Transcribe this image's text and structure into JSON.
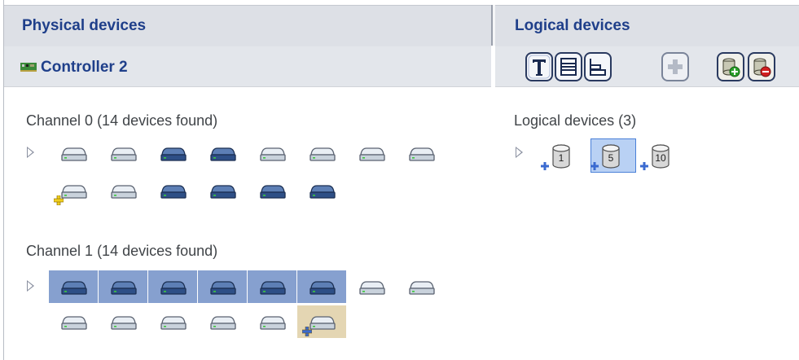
{
  "physical": {
    "title": "Physical devices",
    "controller_label": "Controller 2",
    "channels": [
      {
        "label": "Channel 0   (14 devices found)",
        "rows": [
          [
            "light",
            "light",
            "dark",
            "dark",
            "light",
            "light",
            "light",
            "light"
          ],
          [
            "light-add",
            "light",
            "dark",
            "dark",
            "dark",
            "dark"
          ]
        ]
      },
      {
        "label": "Channel 1   (14 devices found)",
        "rows": [
          [
            "light-sel",
            "light-sel",
            "light-sel",
            "light-sel",
            "light-sel",
            "light-sel",
            "light",
            "light"
          ],
          [
            "light",
            "light",
            "light",
            "light",
            "light",
            "light-hot-add"
          ]
        ]
      }
    ]
  },
  "logical": {
    "title": "Logical devices",
    "count_label": "Logical devices (3)",
    "devices": [
      {
        "raid": "1",
        "selected": false
      },
      {
        "raid": "5",
        "selected": true
      },
      {
        "raid": "10",
        "selected": false
      }
    ],
    "toolbar": [
      "text-view-icon",
      "full-size-view-icon",
      "partial-view-icon",
      "add-icon",
      "create-logical-icon",
      "delete-logical-icon"
    ]
  },
  "colors": {
    "header_text": "#1f3f8a",
    "header_bg": "#dde0e6",
    "selection": "#86a0cf",
    "hot": "#e4d6b3"
  }
}
